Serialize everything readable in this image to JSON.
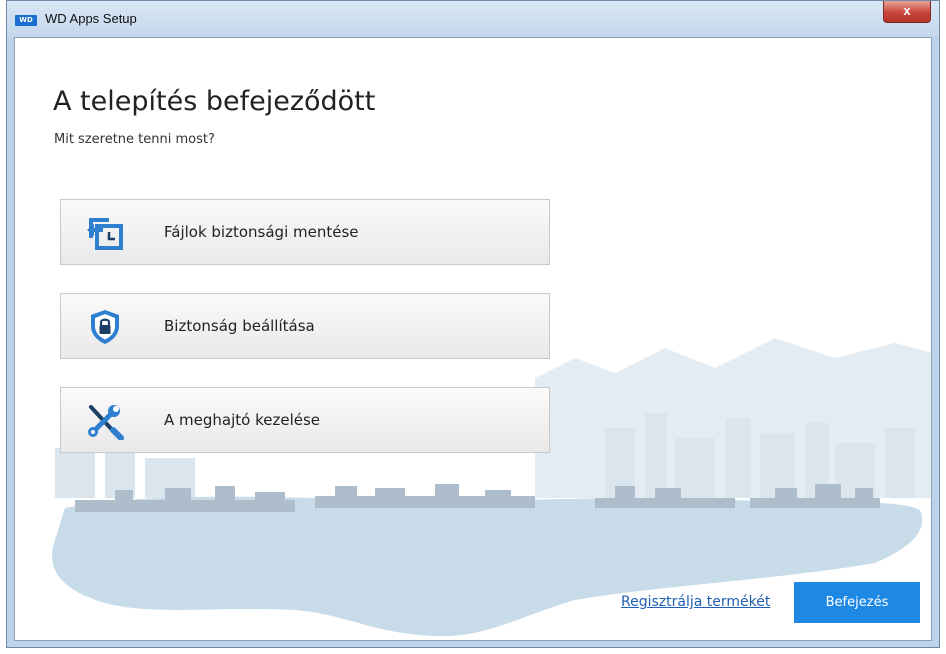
{
  "window": {
    "title": "WD Apps Setup",
    "logo_text": "WD",
    "close_glyph": "x"
  },
  "page": {
    "heading": "A telepítés befejeződött",
    "subheading": "Mit szeretne tenni most?"
  },
  "actions": [
    {
      "label": "Fájlok biztonsági mentése",
      "icon": "backup-icon"
    },
    {
      "label": "Biztonság beállítása",
      "icon": "shield-lock-icon"
    },
    {
      "label": "A meghajtó kezelése",
      "icon": "tools-icon"
    }
  ],
  "footer": {
    "register_link": "Regisztrálja termékét",
    "finish_button": "Befejezés"
  },
  "colors": {
    "accent": "#1e88e5",
    "icon_blue": "#2f7fd1",
    "link": "#1f5fb4"
  }
}
